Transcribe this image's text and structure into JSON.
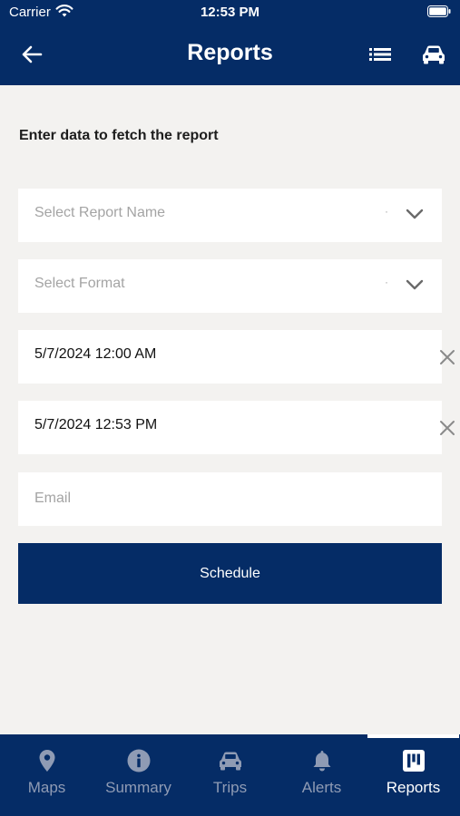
{
  "status_bar": {
    "carrier": "Carrier",
    "time": "12:53 PM"
  },
  "header": {
    "title": "Reports"
  },
  "form": {
    "heading": "Enter data to fetch the report",
    "report_name_placeholder": "Select Report Name",
    "format_placeholder": "Select Format",
    "start_datetime": "5/7/2024 12:00 AM",
    "end_datetime": "5/7/2024 12:53 PM",
    "email_placeholder": "Email",
    "schedule_label": "Schedule"
  },
  "tabs": [
    {
      "label": "Maps",
      "icon": "map-pin-icon"
    },
    {
      "label": "Summary",
      "icon": "info-icon"
    },
    {
      "label": "Trips",
      "icon": "car-icon"
    },
    {
      "label": "Alerts",
      "icon": "bell-icon"
    },
    {
      "label": "Reports",
      "icon": "reports-icon",
      "active": true
    }
  ],
  "colors": {
    "primary": "#052c66",
    "background": "#f3f2f0",
    "inactive_tab": "#8f9bb4"
  }
}
